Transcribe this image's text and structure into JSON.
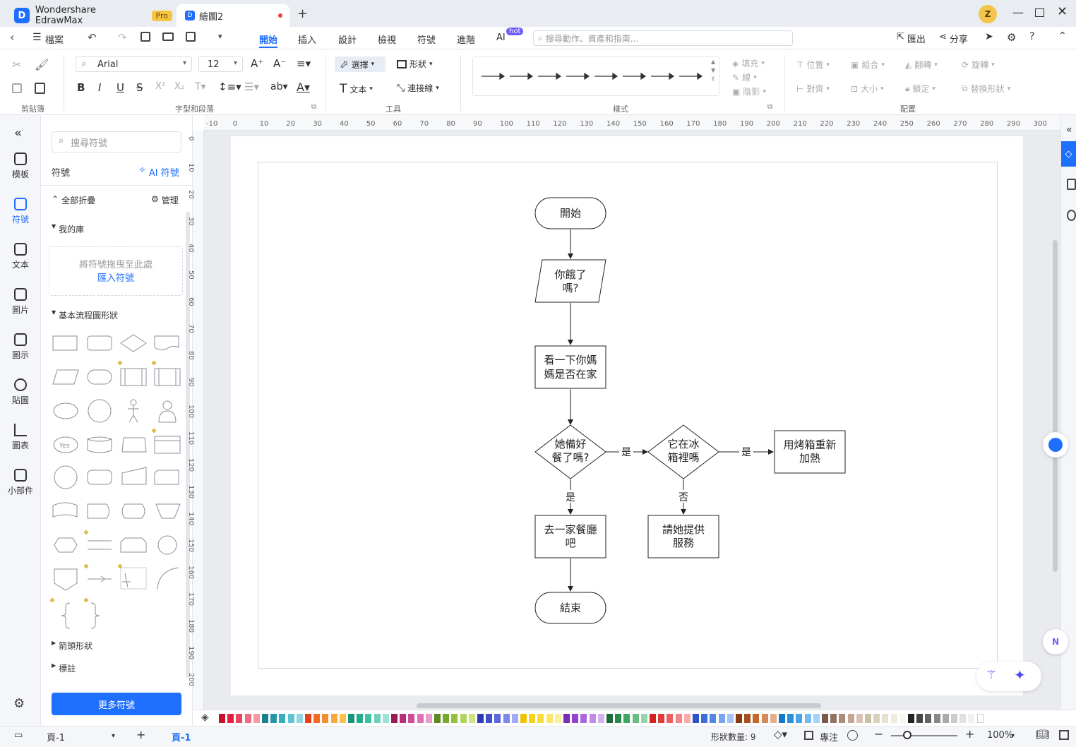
{
  "app": {
    "title": "Wondershare EdrawMax",
    "pro_badge": "Pro"
  },
  "doc_tab": {
    "title": "繪圖2"
  },
  "menu": {
    "file": "檔案",
    "tabs": [
      "開始",
      "插入",
      "設計",
      "檢視",
      "符號",
      "進階",
      "AI"
    ],
    "ai_badge": "hot",
    "search_placeholder": "搜尋動作、資產和指南...",
    "export": "匯出",
    "share": "分享"
  },
  "ribbon": {
    "font": "Arial",
    "font_size": "12",
    "select": "選擇",
    "shape": "形狀",
    "text": "文本",
    "connector": "連接線",
    "fill": "填充",
    "line": "線",
    "shadow": "陰影",
    "position": "位置",
    "group": "組合",
    "flip": "翻轉",
    "rotate": "旋轉",
    "align": "對齊",
    "size": "大小",
    "lock": "鎖定",
    "replace_shape": "替換形狀",
    "groups": [
      "剪貼簿",
      "字型和段落",
      "工具",
      "樣式",
      "配置"
    ]
  },
  "left_rail": [
    "模板",
    "符號",
    "文本",
    "圖片",
    "圖示",
    "貼圖",
    "圖表",
    "小部件"
  ],
  "panel": {
    "search_placeholder": "搜尋符號",
    "title": "符號",
    "ai_symbols": "AI 符號",
    "collapse_all": "全部折疊",
    "manage": "管理",
    "my_library": "我的庫",
    "drop_hint": "將符號拖曳至此處",
    "import_symbols": "匯入符號",
    "basic_flowchart": "基本流程圖形狀",
    "arrows": "箭頭形狀",
    "labels": "標註",
    "more_symbols": "更多符號",
    "yes_shape_text": "Yes"
  },
  "ruler": {
    "top": [
      "-10",
      "0",
      "10",
      "20",
      "30",
      "40",
      "50",
      "60",
      "70",
      "80",
      "90",
      "100",
      "110",
      "120",
      "130",
      "140",
      "150",
      "160",
      "170",
      "180",
      "190",
      "200",
      "210",
      "220",
      "230",
      "240",
      "250",
      "260",
      "270",
      "280",
      "290",
      "300"
    ],
    "left": [
      "0",
      "10",
      "20",
      "30",
      "40",
      "50",
      "60",
      "70",
      "80",
      "90",
      "100",
      "110",
      "120",
      "130",
      "140",
      "150",
      "160",
      "170",
      "180",
      "190",
      "200"
    ]
  },
  "flowchart": {
    "start": "開始",
    "hungry": [
      "你餓了",
      "嗎?"
    ],
    "check_mom": [
      "看一下你媽",
      "媽是否在家"
    ],
    "dinner_ready": [
      "她備好",
      "餐了嗎?"
    ],
    "in_fridge": [
      "它在冰",
      "箱裡嗎"
    ],
    "reheat": [
      "用烤箱重新",
      "加熱"
    ],
    "restaurant": [
      "去一家餐廳",
      "吧"
    ],
    "ask_her": [
      "請她提供",
      "服務"
    ],
    "end": "結束",
    "yes": "是",
    "no": "否"
  },
  "palette": [
    "#c8102e",
    "#e0203a",
    "#e8465c",
    "#ee6f7f",
    "#f29aa6",
    "#1a7f8e",
    "#2596a8",
    "#36aec0",
    "#5ec3d3",
    "#8fd6e2",
    "#e8401c",
    "#f26b21",
    "#f58d2f",
    "#f8a93d",
    "#fac04f",
    "#15947a",
    "#22ab8e",
    "#3fc1a4",
    "#6ed2bb",
    "#9de2d2",
    "#9b1b5a",
    "#b8307a",
    "#cf4d97",
    "#e072b2",
    "#eb9ccc",
    "#5d8a1e",
    "#78a82c",
    "#94c03c",
    "#b0d45a",
    "#cce283",
    "#2a3bb3",
    "#4350cc",
    "#5b68e0",
    "#7d88ea",
    "#a3abf2",
    "#f2c200",
    "#f7d21c",
    "#fadc3c",
    "#fce56a",
    "#fdee9c",
    "#7a2bb8",
    "#9443cf",
    "#ab63de",
    "#c08ae9",
    "#d5b1f2",
    "#1d6b3a",
    "#2a8a4d",
    "#3fa563",
    "#67bd85",
    "#96d4ab",
    "#d42020",
    "#e53a3a",
    "#ee5f5f",
    "#f48585",
    "#f8adad",
    "#2855c8",
    "#3b6ddc",
    "#5486e8",
    "#7aa3f0",
    "#a6c2f6",
    "#8a3b12",
    "#a84f1d",
    "#c3662c",
    "#d6895a",
    "#e6ad8b",
    "#1378c8",
    "#2a8fdc",
    "#4aa5e8",
    "#75bdf0",
    "#a3d3f6",
    "#7a5a48",
    "#957260",
    "#ad8b79",
    "#c4a797",
    "#d9c3b6",
    "#c9c1a8",
    "#d8d1bb",
    "#e6e0ce",
    "#f0ece0",
    "#f8f6ef",
    "#222222",
    "#444444",
    "#666666",
    "#888888",
    "#aaaaaa",
    "#cccccc",
    "#e0e0e0",
    "#f0f0f0",
    "#ffffff"
  ],
  "status": {
    "page_selector": "頁-1",
    "page_tab": "頁-1",
    "shape_count": "形狀數量: 9",
    "focus": "專注",
    "zoom": "100%",
    "zoom_level": 1.0
  },
  "colors": {
    "accent": "#1f6fff",
    "ai_purple": "#6b5cff"
  }
}
